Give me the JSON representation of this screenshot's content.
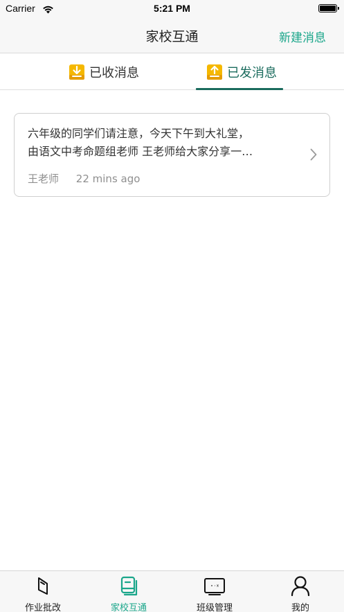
{
  "status_bar": {
    "carrier": "Carrier",
    "time": "5:21 PM"
  },
  "nav": {
    "title": "家校互通",
    "action_label": "新建消息"
  },
  "segments": {
    "items": [
      {
        "label": "已收消息",
        "icon": "inbox-download-icon"
      },
      {
        "label": "已发消息",
        "icon": "outbox-upload-icon"
      }
    ],
    "active_index": 1
  },
  "messages": [
    {
      "line1": "六年级的同学们请注意，今天下午到大礼堂，",
      "line2": "由语文中考命题组老师 王老师给大家分享一…",
      "sender": "王老师",
      "time": "22 mins ago"
    }
  ],
  "tab_bar": {
    "items": [
      {
        "label": "作业批改",
        "icon": "homework-icon"
      },
      {
        "label": "家校互通",
        "icon": "home-school-icon"
      },
      {
        "label": "班级管理",
        "icon": "class-board-icon"
      },
      {
        "label": "我的",
        "icon": "profile-icon"
      }
    ],
    "active_index": 1
  },
  "colors": {
    "accent": "#1aa68a",
    "segment_active": "#1a6b5d",
    "icon_gold": "#f5b800"
  }
}
